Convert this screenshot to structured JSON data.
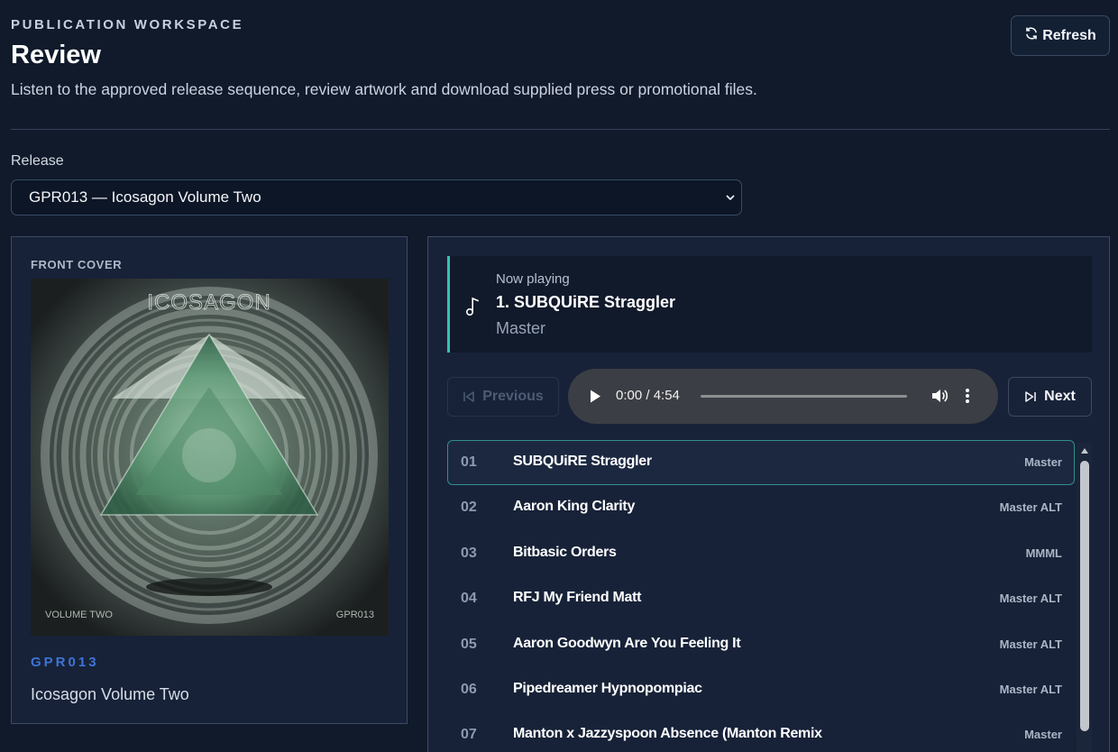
{
  "header": {
    "eyebrow": "PUBLICATION WORKSPACE",
    "title": "Review",
    "subtitle": "Listen to the approved release sequence, review artwork and download supplied press or promotional files.",
    "refresh_label": "Refresh"
  },
  "release": {
    "label": "Release",
    "selected": "GPR013 — Icosagon Volume Two"
  },
  "cover": {
    "section_label": "FRONT COVER",
    "art_title": "ICOSAGON",
    "art_bottom_left": "VOLUME TWO",
    "art_bottom_right": "GPR013",
    "code": "GPR013",
    "name": "Icosagon Volume Two"
  },
  "now_playing": {
    "label": "Now playing",
    "title": "1. SUBQUiRE Straggler",
    "version": "Master"
  },
  "controls": {
    "previous_label": "Previous",
    "next_label": "Next",
    "previous_enabled": false
  },
  "audio": {
    "time": "0:00 / 4:54",
    "progress": 0
  },
  "tracks": [
    {
      "num": "01",
      "name": "SUBQUiRE Straggler",
      "version": "Master"
    },
    {
      "num": "02",
      "name": "Aaron King Clarity",
      "version": "Master ALT"
    },
    {
      "num": "03",
      "name": "Bitbasic Orders",
      "version": "MMML"
    },
    {
      "num": "04",
      "name": "RFJ My Friend Matt",
      "version": "Master ALT"
    },
    {
      "num": "05",
      "name": "Aaron Goodwyn Are You Feeling It",
      "version": "Master ALT"
    },
    {
      "num": "06",
      "name": "Pipedreamer Hypnopompiac",
      "version": "Master ALT"
    },
    {
      "num": "07",
      "name": "Manton x Jazzyspoon Absence (Manton Remix",
      "version": "Master"
    }
  ],
  "colors": {
    "background": "#101a2b",
    "panel": "#172238",
    "accent_teal": "#36c2b1",
    "accent_blue": "#3f74d6"
  }
}
